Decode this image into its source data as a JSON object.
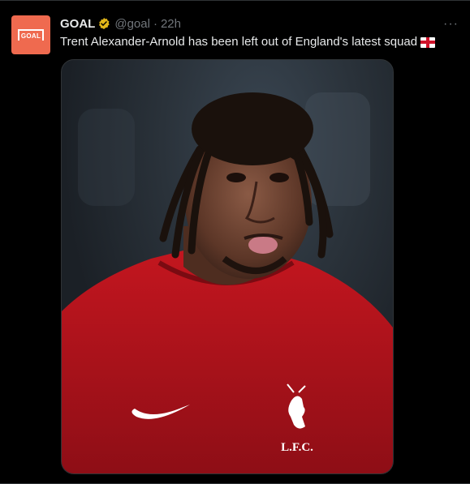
{
  "account": {
    "name": "GOAL",
    "handle": "@goal",
    "separator": "·",
    "time": "22h",
    "logo_text": "GOAL"
  },
  "tweet": {
    "text": "Trent Alexander-Arnold has been left out of England's latest squad",
    "emoji": "england-flag"
  },
  "more_label": "···",
  "media": {
    "crest_text": "L.F.C."
  },
  "colors": {
    "avatar_bg": "#ef6a4f",
    "verified_badge": "#e2b719",
    "text_primary": "#e7e9ea",
    "text_secondary": "#71767b",
    "jersey": "#b3121c"
  }
}
